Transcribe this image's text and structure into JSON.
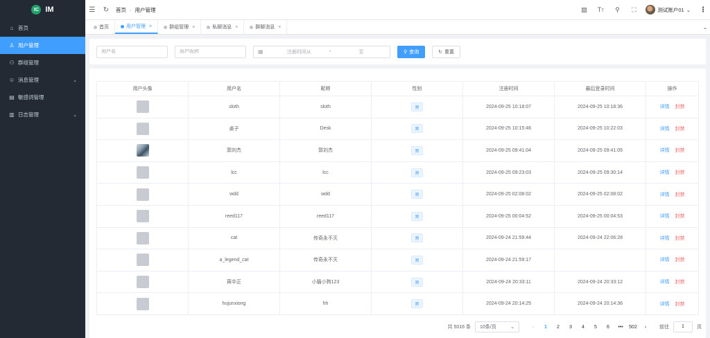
{
  "app": {
    "logo_badge": "IC",
    "logo_text": "IM"
  },
  "sidebar": {
    "items": [
      {
        "label": "首页",
        "icon": "home-icon",
        "glyph": "⌂",
        "active": false,
        "has_children": false
      },
      {
        "label": "用户管理",
        "icon": "user-icon",
        "glyph": "♙",
        "active": true,
        "has_children": false
      },
      {
        "label": "群组管理",
        "icon": "group-icon",
        "glyph": "⚇",
        "active": false,
        "has_children": false
      },
      {
        "label": "消息管理",
        "icon": "message-icon",
        "glyph": "☺",
        "active": false,
        "has_children": true
      },
      {
        "label": "敏感词管理",
        "icon": "document-icon",
        "glyph": "▤",
        "active": false,
        "has_children": false
      },
      {
        "label": "日志管理",
        "icon": "log-icon",
        "glyph": "▥",
        "active": false,
        "has_children": true
      }
    ]
  },
  "topbar": {
    "breadcrumb": {
      "home": "首页",
      "separator": "›",
      "current": "用户管理"
    },
    "user_name": "测试账户01"
  },
  "tags": [
    {
      "label": "首页",
      "active": false,
      "closable": false
    },
    {
      "label": "用户管理",
      "active": true,
      "closable": true
    },
    {
      "label": "群组管理",
      "active": false,
      "closable": true
    },
    {
      "label": "私聊消息",
      "active": false,
      "closable": true
    },
    {
      "label": "群聊消息",
      "active": false,
      "closable": true
    }
  ],
  "search": {
    "username_placeholder": "用户名",
    "nickname_placeholder": "用户昵称",
    "date_start_placeholder": "注册时间从",
    "date_separator": "-",
    "date_end_placeholder": "至",
    "query_label": "查询",
    "reset_label": "重置"
  },
  "table": {
    "headers": [
      "用户头像",
      "用户名",
      "昵称",
      "性别",
      "注册时间",
      "最后登录时间",
      "操作"
    ],
    "detail_label": "详情",
    "ban_label": "封禁",
    "rows": [
      {
        "avatar": "placeholder",
        "username": "sloth",
        "nickname": "sloth",
        "gender": "男",
        "register_time": "2024-09-25 10:18:07",
        "last_login": "2024-09-25 10:18:36"
      },
      {
        "avatar": "placeholder",
        "username": "桌子",
        "nickname": "Desk",
        "gender": "男",
        "register_time": "2024-09-25 10:15:46",
        "last_login": "2024-09-25 10:22:03"
      },
      {
        "avatar": "photo",
        "username": "郭刘杰",
        "nickname": "郭刘杰",
        "gender": "男",
        "register_time": "2024-09-25 09:41:04",
        "last_login": "2024-09-25 09:41:05"
      },
      {
        "avatar": "placeholder",
        "username": "lcc",
        "nickname": "lcc",
        "gender": "男",
        "register_time": "2024-09-25 09:23:03",
        "last_login": "2024-09-25 09:30:14"
      },
      {
        "avatar": "placeholder",
        "username": "wdd",
        "nickname": "wdd",
        "gender": "男",
        "register_time": "2024-09-25 02:08:02",
        "last_login": "2024-09-25 02:08:02"
      },
      {
        "avatar": "placeholder",
        "username": "reed117",
        "nickname": "reed117",
        "gender": "男",
        "register_time": "2024-09-25 00:04:52",
        "last_login": "2024-09-25 00:04:53"
      },
      {
        "avatar": "placeholder",
        "username": "cat",
        "nickname": "传奇永不灭",
        "gender": "男",
        "register_time": "2024-09-24 21:59:44",
        "last_login": "2024-09-24 22:06:28"
      },
      {
        "avatar": "placeholder",
        "username": "a_legend_cat",
        "nickname": "传奇永不灭",
        "gender": "男",
        "register_time": "2024-09-24 21:59:17",
        "last_login": ""
      },
      {
        "avatar": "placeholder",
        "username": "蒋中正",
        "nickname": "小猫小狗123",
        "gender": "男",
        "register_time": "2024-09-24 20:33:11",
        "last_login": "2024-09-24 20:33:12"
      },
      {
        "avatar": "placeholder",
        "username": "hujunxiong",
        "nickname": "hh",
        "gender": "男",
        "register_time": "2024-09-24 20:14:25",
        "last_login": "2024-09-24 20:14:36"
      }
    ]
  },
  "pagination": {
    "total_text": "共 5016 条",
    "page_size": "10条/页",
    "pages": [
      "1",
      "2",
      "3",
      "4",
      "5",
      "6"
    ],
    "current_page": "1",
    "ellipsis": "•••",
    "last_page": "502",
    "goto_label": "前往",
    "goto_value": "1",
    "goto_suffix": "页"
  },
  "colors": {
    "primary": "#409eff",
    "danger": "#f56c6c",
    "sidebar_bg": "#232a33",
    "logo_green": "#22a06b"
  }
}
